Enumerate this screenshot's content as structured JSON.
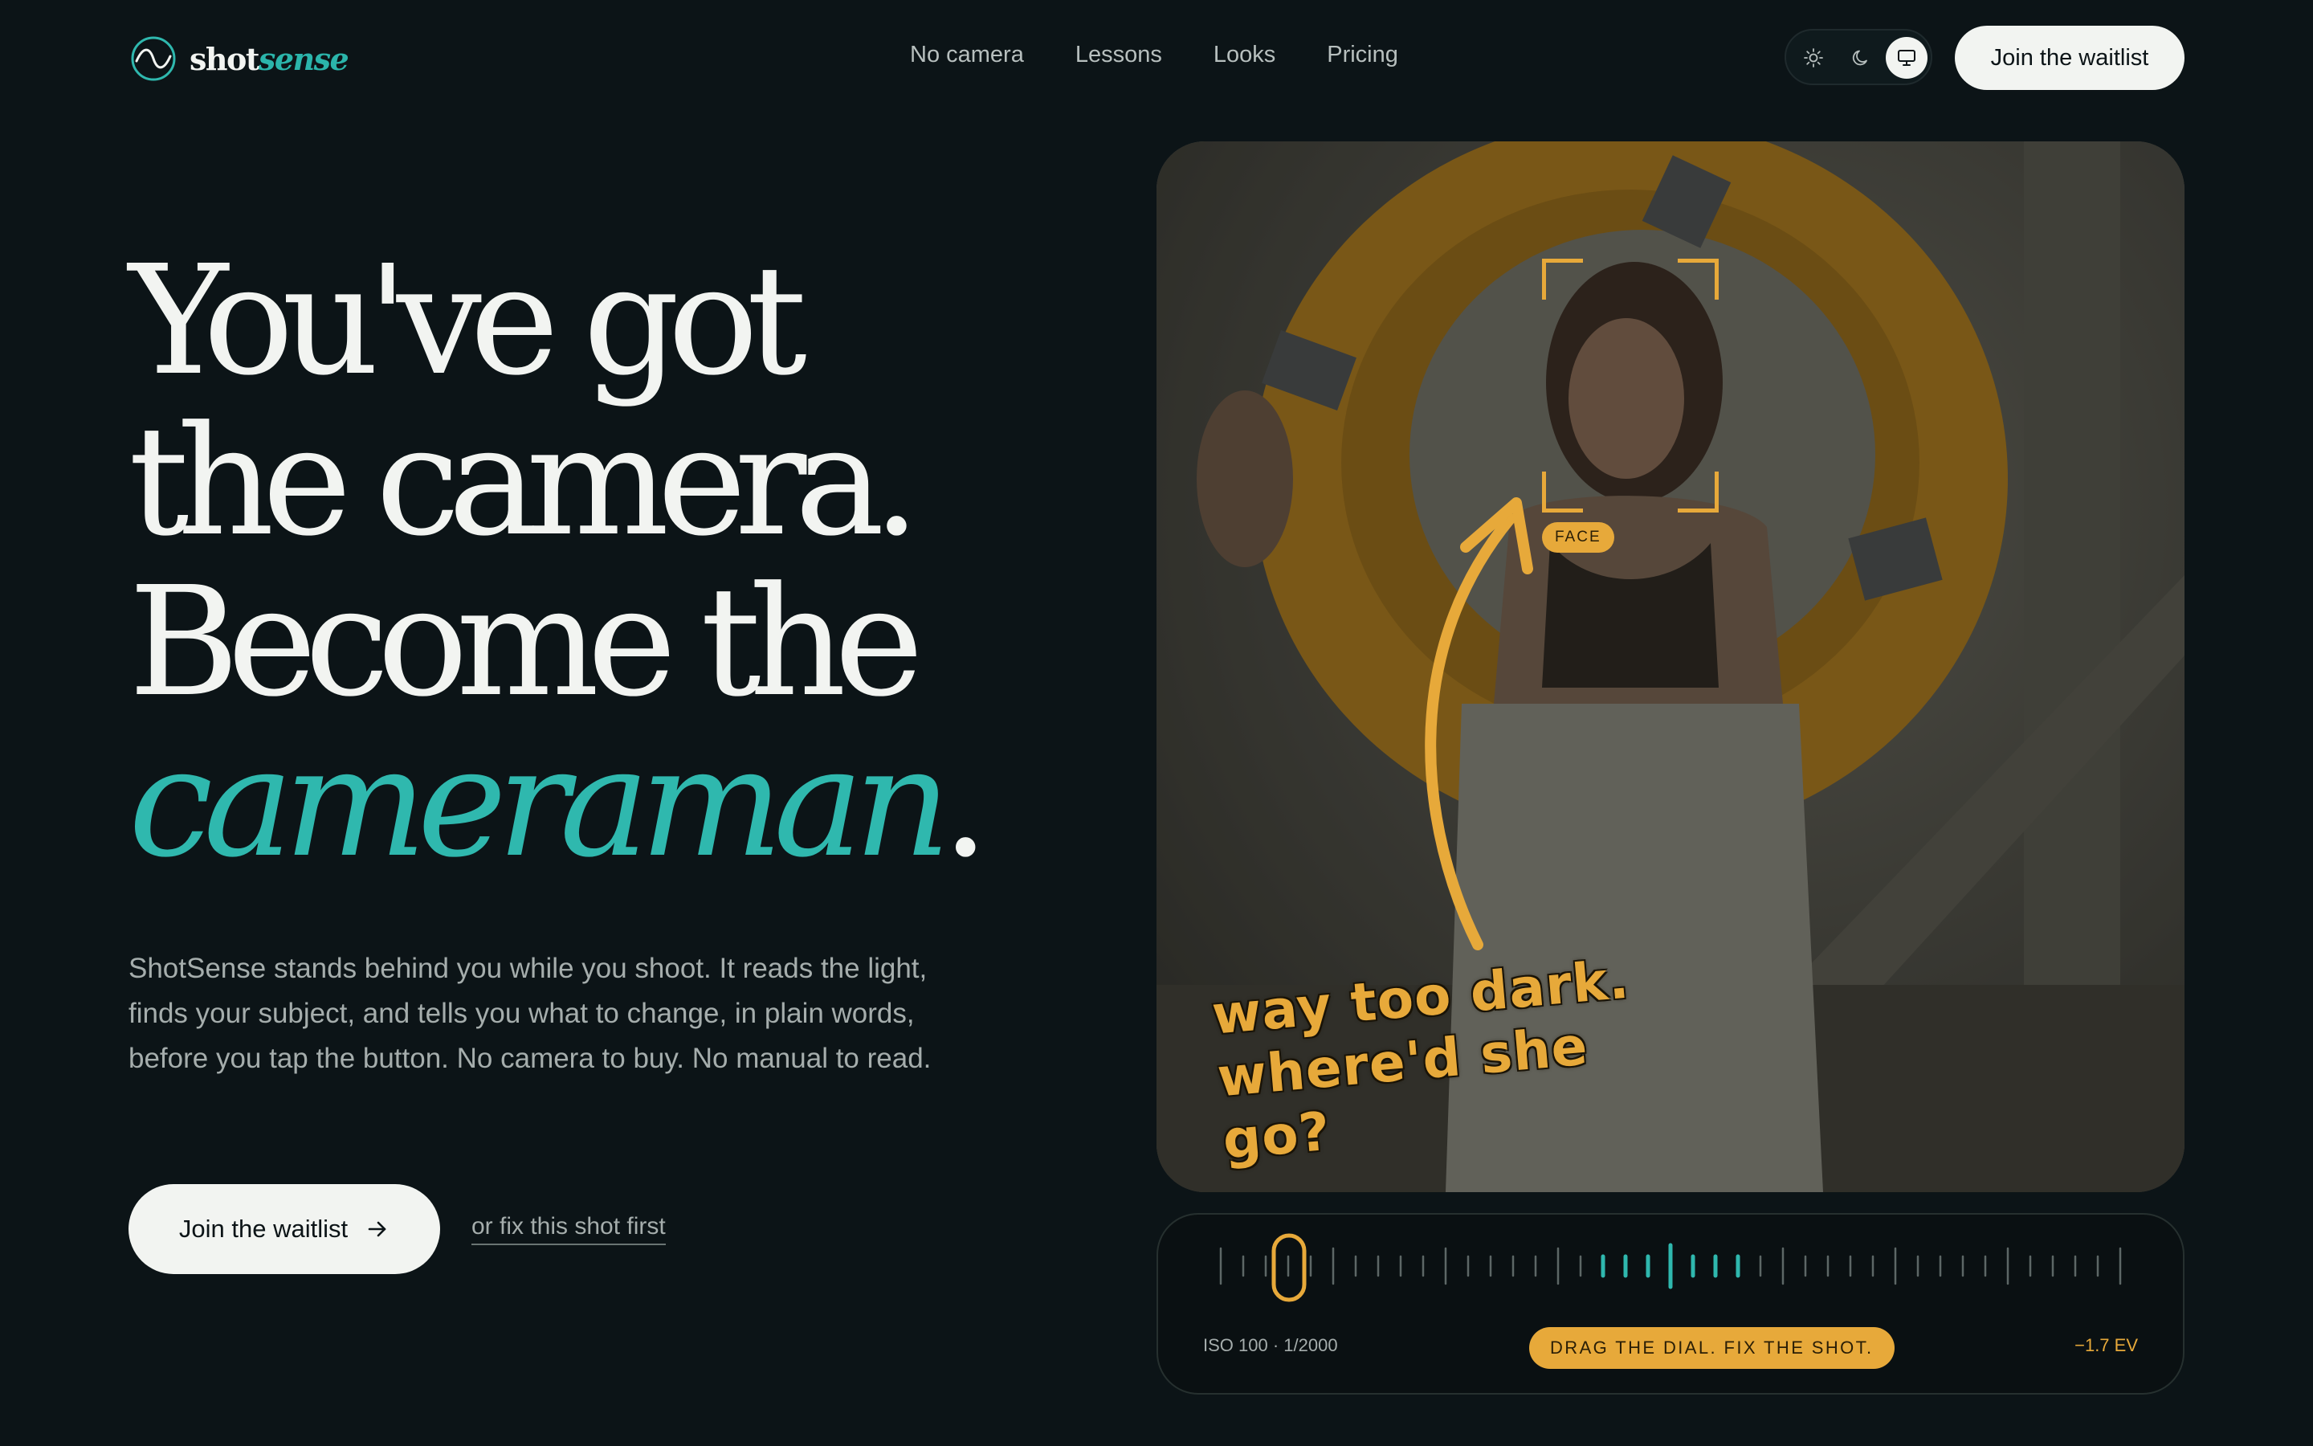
{
  "nav": {
    "logo_prefix": "shot",
    "logo_suffix": "sense",
    "links": [
      "No camera",
      "Lessons",
      "Looks",
      "Pricing"
    ],
    "theme_options": [
      "sun-icon",
      "moon-icon",
      "monitor-icon"
    ],
    "theme_selected": "monitor-icon",
    "cta_label": "Join the waitlist"
  },
  "hero": {
    "headline_lines": [
      "You've got",
      "the camera.",
      "Become the"
    ],
    "headline_accent": "cameraman",
    "headline_accent_end": ".",
    "lead": "ShotSense stands behind you while you shoot. It reads the light, finds your subject, and tells you what to change, in plain words, before you tap the button. No camera to buy. No manual to read.",
    "primary_cta": "Join the waitlist",
    "secondary_cta": "or fix this shot first"
  },
  "photo": {
    "face_label": "FACE",
    "annotation_line1": "way too dark.",
    "annotation_line2": "where'd she go?"
  },
  "dial": {
    "exposure_readout": "ISO 100 · 1/2000",
    "prompt": "DRAG THE DIAL. FIX THE SHOT.",
    "ev_value": "−1.7 EV"
  },
  "colors": {
    "background": "#0c1417",
    "accent_teal": "#2fb8ae",
    "accent_amber": "#e7a93a",
    "button_light": "#f2f4f1"
  }
}
